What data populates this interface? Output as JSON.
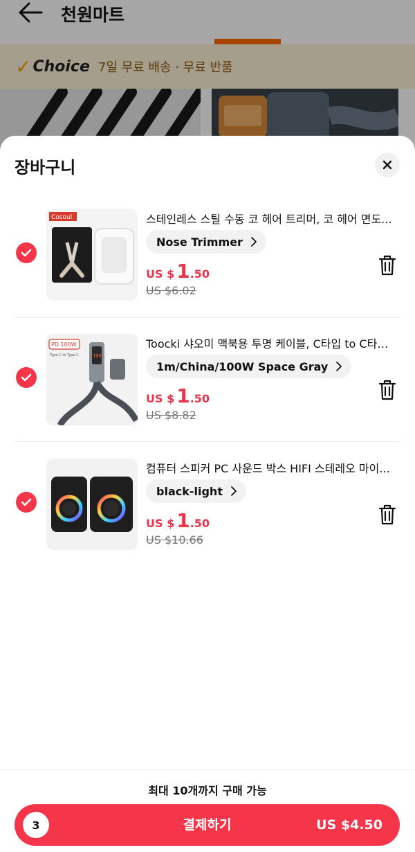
{
  "background": {
    "store_title": "천원마트",
    "choice_badge": "Choice",
    "choice_text": "7일 무료 배송 · 무료 반품"
  },
  "sheet": {
    "title": "장바구니",
    "items": [
      {
        "title": "스테인레스 스틸 수동 코 헤어 트리머, 코 헤어 면도...",
        "variant": "Nose Trimmer",
        "currency": "US $",
        "price_whole": "1",
        "price_decimal": ".50",
        "original_price": "US $6.02",
        "thumb_brand": "Cosoul",
        "selected": true
      },
      {
        "title": "Toocki 샤오미 맥북용 투명 케이블, C타입 to C타입...",
        "variant": "1m/China/100W Space Gray",
        "currency": "US $",
        "price_whole": "1",
        "price_decimal": ".50",
        "original_price": "US $8.82",
        "thumb_badge": "PD 100W",
        "thumb_sub": "Type-C to Type-C",
        "selected": true
      },
      {
        "title": "컴퓨터 스피커 PC 사운드 박스 HIFI 스테레오 마이...",
        "variant": "black-light",
        "currency": "US $",
        "price_whole": "1",
        "price_decimal": ".50",
        "original_price": "US $10.66",
        "selected": true
      }
    ]
  },
  "footer": {
    "limit_text": "최대 10개까지 구매 가능",
    "item_count": "3",
    "checkout_label": "결제하기",
    "total": "US $4.50"
  },
  "colors": {
    "accent": "#f5354a",
    "price": "#e8344c",
    "choice_bg": "#fdf3d9"
  }
}
